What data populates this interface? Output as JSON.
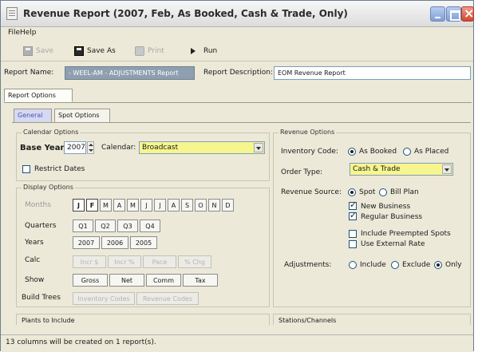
{
  "window": {
    "title": "Revenue Report  (2007, Feb, As Booked, Cash & Trade, Only)"
  },
  "menu": {
    "file": "File",
    "help": "Help"
  },
  "toolbar": {
    "save": "Save",
    "save_as": "Save As",
    "print": "Print",
    "run": "Run"
  },
  "report": {
    "name_label": "Report Name:",
    "name_value": "- WEEL-AM - ADJUSTMENTS Report",
    "description_label": "Report Description:",
    "description_value": "EOM Revenue Report"
  },
  "tabs": {
    "report_options": "Report Options",
    "general": "General",
    "spot_options": "Spot Options"
  },
  "calendar_options": {
    "title": "Calendar Options",
    "base_year_label": "Base Year:",
    "base_year": "2007",
    "calendar_label": "Calendar:",
    "calendar_value": "Broadcast",
    "restrict_dates": "Restrict Dates"
  },
  "display_options": {
    "title": "Display Options",
    "months_label": "Months",
    "months": [
      "J",
      "F",
      "M",
      "A",
      "M",
      "J",
      "J",
      "A",
      "S",
      "O",
      "N",
      "D"
    ],
    "quarters_label": "Quarters",
    "quarters": [
      "Q1",
      "Q2",
      "Q3",
      "Q4"
    ],
    "years_label": "Years",
    "years": [
      "2007",
      "2006",
      "2005"
    ],
    "calc_label": "Calc",
    "calc_buttons": [
      "Incr $",
      "Incr %",
      "Pace",
      "% Chg"
    ],
    "show_label": "Show",
    "show_buttons": [
      "Gross",
      "Net",
      "Comm",
      "Tax"
    ],
    "build_trees_label": "Build Trees",
    "build_trees_buttons": [
      "Inventory Codes",
      "Revenue Codes"
    ]
  },
  "revenue_options": {
    "title": "Revenue Options",
    "inventory_code_label": "Inventory Code:",
    "as_booked": "As Booked",
    "as_placed": "As Placed",
    "order_type_label": "Order Type:",
    "order_type_value": "Cash & Trade",
    "revenue_source_label": "Revenue Source:",
    "spot": "Spot",
    "bill_plan": "Bill Plan",
    "new_business": "New Business",
    "regular_business": "Regular Business",
    "include_preempted": "Include Preempted Spots",
    "use_external_rate": "Use External Rate",
    "adjustments_label": "Adjustments:",
    "include": "Include",
    "exclude": "Exclude",
    "only": "Only"
  },
  "sections": {
    "plants": "Plants to Include",
    "stations": "Stations/Channels"
  },
  "status": {
    "text": "13 columns will be created on 1 report(s)."
  }
}
